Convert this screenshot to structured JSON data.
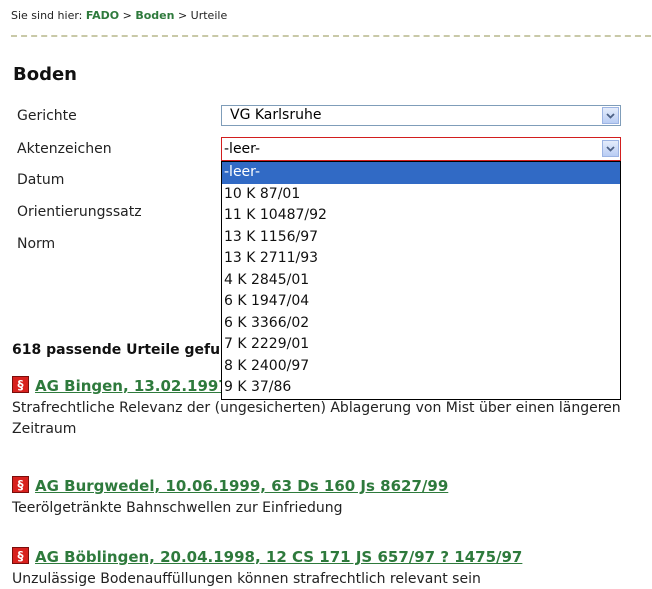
{
  "breadcrumb": {
    "prefix": "Sie sind hier:",
    "items": [
      "FADO",
      "Boden",
      "Urteile"
    ],
    "separator": ">"
  },
  "page_title": "Boden",
  "form": {
    "labels": {
      "gerichte": "Gerichte",
      "aktenzeichen": "Aktenzeichen",
      "datum": "Datum",
      "orientierungssatz": "Orientierungssatz",
      "norm": "Norm"
    },
    "gerichte_value": "VG Karlsruhe",
    "aktenzeichen_value": "-leer-",
    "aktenzeichen_options": [
      "-leer-",
      "10 K 87/01",
      "11 K 10487/92",
      "13 K 1156/97",
      "13 K 2711/93",
      "4 K 2845/01",
      "6 K 1947/04",
      "6 K 3366/02",
      "7 K 2229/01",
      "8 K 2400/97",
      "9 K 37/86"
    ]
  },
  "results": {
    "count_text": "618 passende Urteile gefu",
    "items": [
      {
        "title": "AG Bingen, 13.02.1997,",
        "description": "Strafrechtliche Relevanz der (ungesicherten) Ablagerung von Mist über einen längeren Zeitraum"
      },
      {
        "title": "AG Burgwedel, 10.06.1999, 63 Ds 160 Js 8627/99",
        "description": "Teerölgetränkte Bahnschwellen zur Einfriedung"
      },
      {
        "title": "AG Böblingen, 20.04.1998, 12 CS 171 JS 657/97 ? 1475/97",
        "description": "Unzulässige Bodenauffüllungen können strafrechtlich relevant sein"
      }
    ]
  },
  "icons": {
    "paragraph": "paragraph-icon",
    "dropdown_arrow": "chevron-down-icon"
  },
  "colors": {
    "link_green": "#2e7a3c",
    "selection_blue": "#316ac5",
    "paragraph_red": "#d8211e",
    "focus_border": "#d21e1e"
  }
}
